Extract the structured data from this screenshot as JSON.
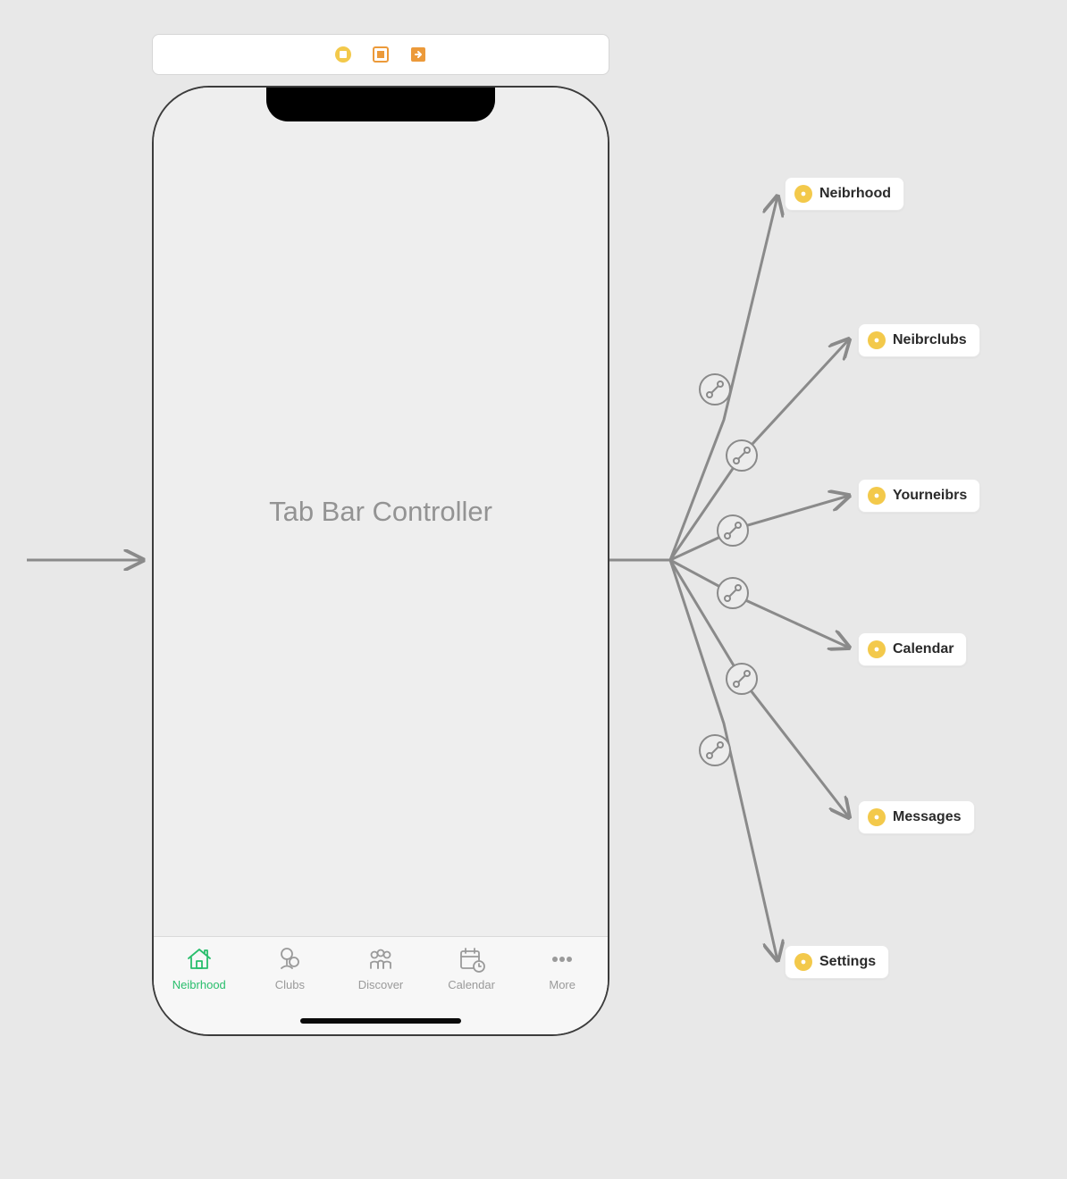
{
  "scene": {
    "title": "Tab Bar Controller"
  },
  "tabs": [
    {
      "label": "Neibrhood",
      "icon": "house-icon",
      "active": true
    },
    {
      "label": "Clubs",
      "icon": "clubs-icon",
      "active": false
    },
    {
      "label": "Discover",
      "icon": "people-icon",
      "active": false
    },
    {
      "label": "Calendar",
      "icon": "calendar-icon",
      "active": false
    },
    {
      "label": "More",
      "icon": "more-icon",
      "active": false
    }
  ],
  "destinations": [
    {
      "label": "Neibrhood"
    },
    {
      "label": "Neibrclubs"
    },
    {
      "label": "Yourneibrs"
    },
    {
      "label": "Calendar"
    },
    {
      "label": "Messages"
    },
    {
      "label": "Settings"
    }
  ],
  "colors": {
    "active": "#29be6c",
    "inactive": "#9a9a9a",
    "dest_icon": "#f3c94b"
  }
}
